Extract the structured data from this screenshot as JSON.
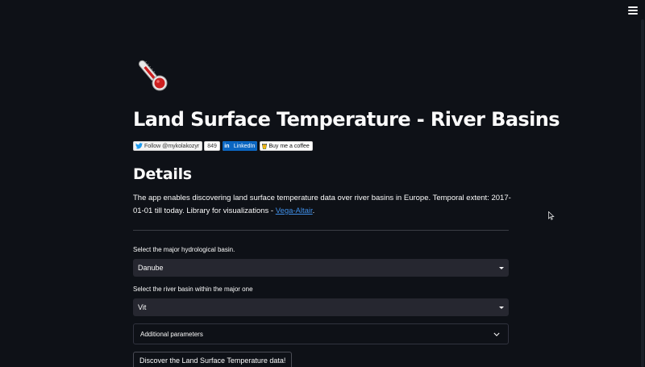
{
  "header": {
    "menu_icon": "hamburger-menu-icon"
  },
  "page": {
    "logo_icon": "thermometer-icon",
    "title": "Land Surface Temperature - River Basins"
  },
  "badges": {
    "twitter_label": "Follow @mykolakozyr",
    "twitter_count": "849",
    "linkedin_label": "LinkedIn",
    "linkedin_logo": "in",
    "coffee_label": "Buy me a coffee"
  },
  "details": {
    "heading": "Details",
    "text_before": "The app enables discovering land surface temperature data over river basins in Europe. Temporal extent: 2017-01-01 till today. Library for visualizations - ",
    "link_text": "Vega-Altair",
    "text_after": "."
  },
  "form": {
    "major_basin_label": "Select the major hydrological basin.",
    "major_basin_value": "Danube",
    "river_basin_label": "Select the river basin within the major one",
    "river_basin_value": "Vit",
    "expander_label": "Additional parameters",
    "submit_label": "Discover the Land Surface Temperature data!"
  },
  "colors": {
    "background": "#0e1117",
    "input_bg": "#262730",
    "link": "#3f8fe8",
    "linkedin": "#0a66c2"
  }
}
